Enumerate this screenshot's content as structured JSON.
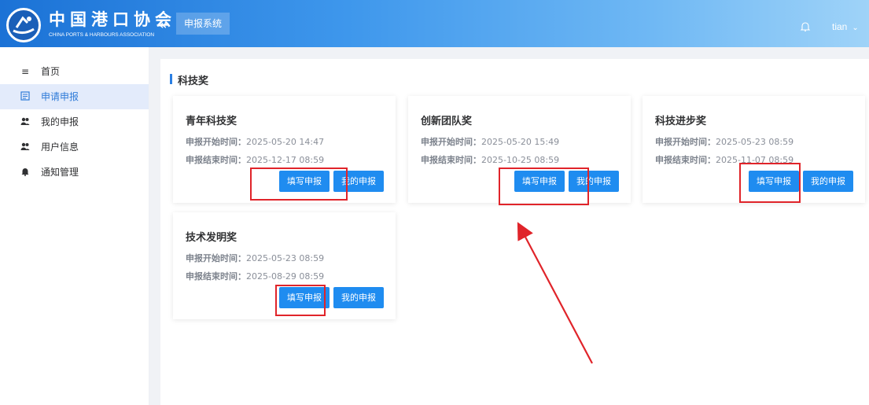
{
  "header": {
    "logo_cn": "中国港口协会",
    "logo_en": "CHINA PORTS & HARBOURS ASSOCIATION",
    "collapse_glyph": "«",
    "system_tab": "申报系统",
    "bell_icon": "bell-icon",
    "username": "tian",
    "gradient": [
      "#1b72d6",
      "#9fd3f8"
    ]
  },
  "sidebar": {
    "items": [
      {
        "label": "首页",
        "icon": "menu-icon",
        "active": false
      },
      {
        "label": "申请申报",
        "icon": "form-icon",
        "active": true
      },
      {
        "label": "我的申报",
        "icon": "users-icon",
        "active": false
      },
      {
        "label": "用户信息",
        "icon": "users-icon",
        "active": false
      },
      {
        "label": "通知管理",
        "icon": "bell-icon",
        "active": false
      }
    ],
    "active_color": "#2f7bd8"
  },
  "section": {
    "title": "科技奖"
  },
  "cards": [
    {
      "title": "青年科技奖",
      "start_label": "申报开始时间：",
      "start": "2025-05-20 14:47",
      "end_label": "申报结束时间：",
      "end": "2025-12-17 08:59",
      "fill_btn": "填写申报",
      "my_btn": "我的申报"
    },
    {
      "title": "创新团队奖",
      "start_label": "申报开始时间：",
      "start": "2025-05-20 15:49",
      "end_label": "申报结束时间：",
      "end": "2025-10-25 08:59",
      "fill_btn": "填写申报",
      "my_btn": "我的申报"
    },
    {
      "title": "科技进步奖",
      "start_label": "申报开始时间：",
      "start": "2025-05-23 08:59",
      "end_label": "申报结束时间：",
      "end": "2025-11-07 08:59",
      "fill_btn": "填写申报",
      "my_btn": "我的申报"
    },
    {
      "title": "技术发明奖",
      "start_label": "申报开始时间：",
      "start": "2025-05-23 08:59",
      "end_label": "申报结束时间：",
      "end": "2025-08-29 08:59",
      "fill_btn": "填写申报",
      "my_btn": "我的申报"
    }
  ],
  "colors": {
    "button": "#1f8cf0",
    "highlight": "#e0242a",
    "accent": "#2a7fe3"
  }
}
